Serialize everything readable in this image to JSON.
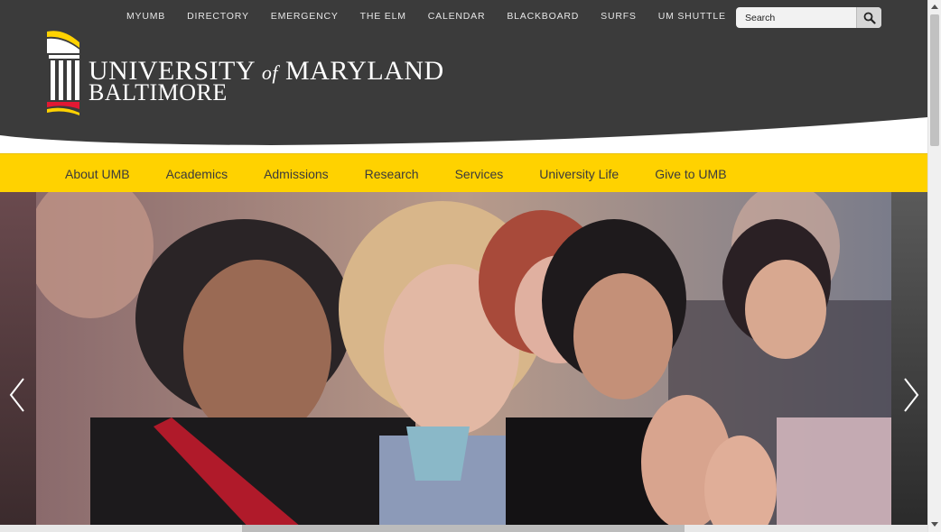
{
  "utility_nav": {
    "items": [
      "MYUMB",
      "DIRECTORY",
      "EMERGENCY",
      "THE ELM",
      "CALENDAR",
      "BLACKBOARD",
      "SURFS",
      "UM SHUTTLE"
    ]
  },
  "search": {
    "placeholder": "Search",
    "icon": "search-icon"
  },
  "logo": {
    "line1_a": "UNIVERSITY",
    "line1_of": "of",
    "line1_b": "MARYLAND",
    "line2": "BALTIMORE"
  },
  "main_nav": {
    "items": [
      "About UMB",
      "Academics",
      "Admissions",
      "Research",
      "Services",
      "University Life",
      "Give to UMB"
    ]
  },
  "hero": {
    "prev_icon": "chevron-left-icon",
    "next_icon": "chevron-right-icon"
  },
  "colors": {
    "header_bg": "#3b3b3b",
    "brand_yellow": "#ffd200",
    "brand_red": "#e21833",
    "nav_text": "#3b3b3b"
  }
}
